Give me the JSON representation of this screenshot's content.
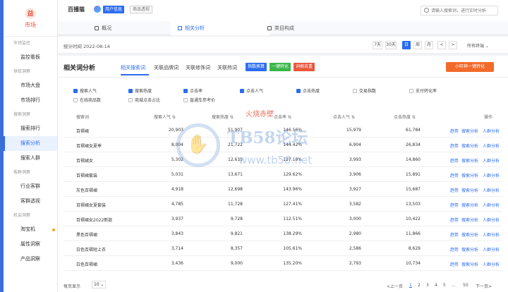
{
  "sidebar": {
    "logo_glyph": "益",
    "logo_label": "市场",
    "groups": [
      {
        "title": "市场监控",
        "items": [
          "监控看板"
        ]
      },
      {
        "title": "供给洞察",
        "items": [
          "市场大盘",
          "市场排行"
        ]
      },
      {
        "title": "搜索洞察",
        "items": [
          "搜索排行",
          "搜索分析",
          "搜索人群"
        ]
      },
      {
        "title": "客群洞察",
        "items": [
          "行业客群",
          "客群透视"
        ]
      },
      {
        "title": "机会洞察",
        "items": [
          "淘宝机",
          "属性洞察",
          "产品洞察"
        ]
      }
    ],
    "active_item": "搜索分析"
  },
  "header": {
    "shop_name": "百播猫",
    "tag_user": "用户信息",
    "tag_store": "商品透视",
    "search_placeholder": "请输入搜索词，进行实时分析"
  },
  "tabs": [
    "概况",
    "相关分析",
    "类目构成"
  ],
  "active_tab": "相关分析",
  "daterow": {
    "stat_time": "统计时间 2022-08-14",
    "buttons": [
      "7天",
      "30天",
      "日",
      "周",
      "月",
      "<",
      ">"
    ],
    "active_button": "日",
    "terminal": "所有终端 ⌄"
  },
  "panel": {
    "title": "相关词分析",
    "subtabs": [
      "相关搜索词",
      "关联品牌词",
      "关联修饰词",
      "关联热词"
    ],
    "btn_index": "指数换算",
    "btn_convert": "一键转化",
    "btn_remove": "词根去重",
    "btn_one_click": "小旺神一键转化",
    "filters": [
      {
        "label": "搜索人气",
        "checked": true
      },
      {
        "label": "搜索热度",
        "checked": true
      },
      {
        "label": "点击率",
        "checked": true
      },
      {
        "label": "点击人气",
        "checked": true
      },
      {
        "label": "点击热度",
        "checked": true
      },
      {
        "label": "交易指数",
        "checked": false
      },
      {
        "label": "支付转化率",
        "checked": false
      },
      {
        "label": "在线商品数",
        "checked": false
      },
      {
        "label": "商城点击占比",
        "checked": false
      },
      {
        "label": "直通车参考价",
        "checked": false
      }
    ]
  },
  "table": {
    "headers": [
      "搜索词",
      "搜索人气 ⇅",
      "搜索热度 ⇅",
      "点击率 ⇅",
      "点击人气 ⇅",
      "点击热度 ⇅",
      "操作"
    ],
    "rows": [
      [
        "百褶裙",
        "20,903",
        "51,907",
        "146.56%",
        "15,979",
        "61,784"
      ],
      [
        "百褶裙女夏季",
        "8,004",
        "21,722",
        "144.42%",
        "6,904",
        "26,834"
      ],
      [
        "百褶裙女",
        "5,302",
        "12,615",
        "127.16%",
        "3,993",
        "14,860"
      ],
      [
        "百褶裙套装",
        "5,031",
        "13,671",
        "129.62%",
        "3,906",
        "15,891"
      ],
      [
        "灰色百褶裙",
        "4,918",
        "12,698",
        "143.96%",
        "3,927",
        "15,687"
      ],
      [
        "百褶裙女夏套装",
        "4,785",
        "11,728",
        "127.41%",
        "3,582",
        "13,503"
      ],
      [
        "百褶裙女2022新款",
        "3,937",
        "9,728",
        "112.51%",
        "3,000",
        "10,422"
      ],
      [
        "黑色百褶裙",
        "3,843",
        "9,821",
        "138.29%",
        "2,980",
        "11,866"
      ],
      [
        "白色百褶短上衣",
        "3,714",
        "8,357",
        "105.61%",
        "2,586",
        "8,629"
      ],
      [
        "白色百褶裙",
        "3,436",
        "9,000",
        "135.20%",
        "2,793",
        "10,734"
      ]
    ],
    "actions": [
      "趋势",
      "搜索分析",
      "人群分析"
    ]
  },
  "footer": {
    "per_page_label": "每页显示",
    "per_page_value": "10 ⌄",
    "pages": [
      "<上一页",
      "1",
      "2",
      "3",
      "4",
      "5",
      "...",
      "50",
      "下一页>"
    ],
    "active_page": "1"
  },
  "watermark": {
    "red_text": "火烧赤壁",
    "brand": "TB58论坛",
    "url": "www.tb58.net"
  },
  "colors": {
    "accent": "#2c6cf0",
    "brand_orange": "#f26a2a",
    "green_btn": "#3bb54a",
    "red_btn": "#e8563c"
  }
}
